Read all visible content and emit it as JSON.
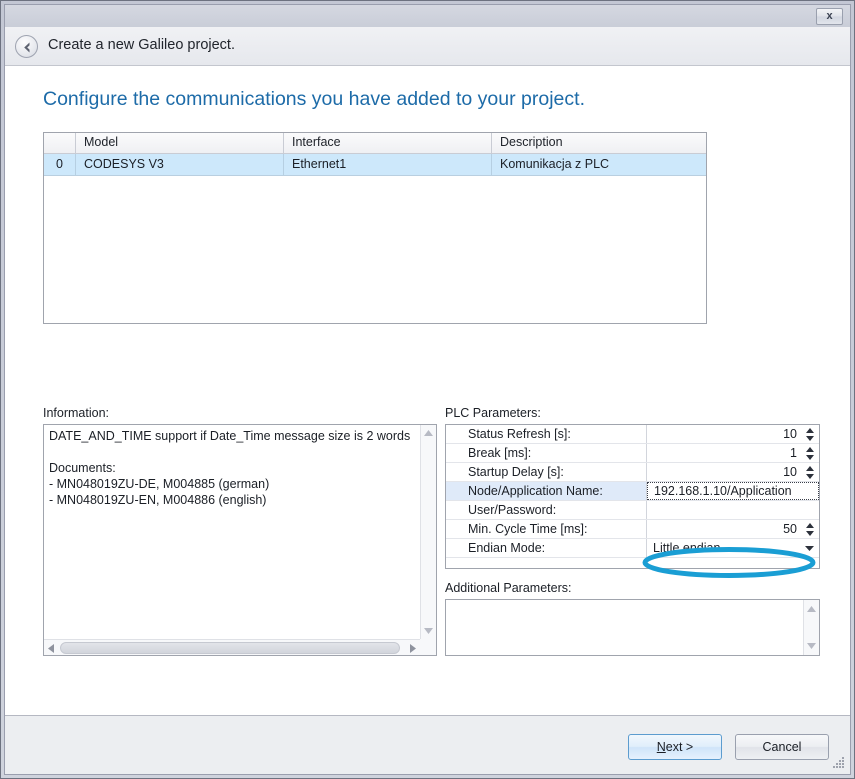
{
  "window": {
    "close_label": "x",
    "nav_title": "Create a new Galileo project.",
    "heading": "Configure the communications you have added to your project."
  },
  "comm_table": {
    "columns": [
      "",
      "Model",
      "Interface",
      "Description"
    ],
    "rows": [
      {
        "index": "0",
        "model": "CODESYS V3",
        "interface": "Ethernet1",
        "description": "Komunikacja z PLC"
      }
    ]
  },
  "information": {
    "label": "Information:",
    "text": "DATE_AND_TIME support if Date_Time message size is 2 words\n\nDocuments:\n- MN048019ZU-DE, M004885 (german)\n- MN048019ZU-EN, M004886 (english)"
  },
  "plc_parameters": {
    "label": "PLC Parameters:",
    "rows": [
      {
        "label": "Status Refresh [s]:",
        "value": "10",
        "kind": "spinner"
      },
      {
        "label": "Break [ms]:",
        "value": "1",
        "kind": "spinner"
      },
      {
        "label": "Startup Delay [s]:",
        "value": "10",
        "kind": "spinner"
      },
      {
        "label": "Node/Application Name:",
        "value": "192.168.1.10/Application",
        "kind": "text"
      },
      {
        "label": "User/Password:",
        "value": "",
        "kind": "text"
      },
      {
        "label": "Min. Cycle Time [ms]:",
        "value": "50",
        "kind": "spinner"
      },
      {
        "label": "Endian Mode:",
        "value": "Little endian",
        "kind": "dropdown"
      }
    ]
  },
  "additional_parameters": {
    "label": "Additional Parameters:",
    "value": ""
  },
  "footer": {
    "next_mnemonic": "N",
    "next_rest": "ext >",
    "cancel_label": "Cancel"
  },
  "colors": {
    "heading": "#1d6ba8",
    "selection": "#cde8fb",
    "annotation": "#1a9ed4",
    "row_highlight": "#dfeaf9"
  }
}
